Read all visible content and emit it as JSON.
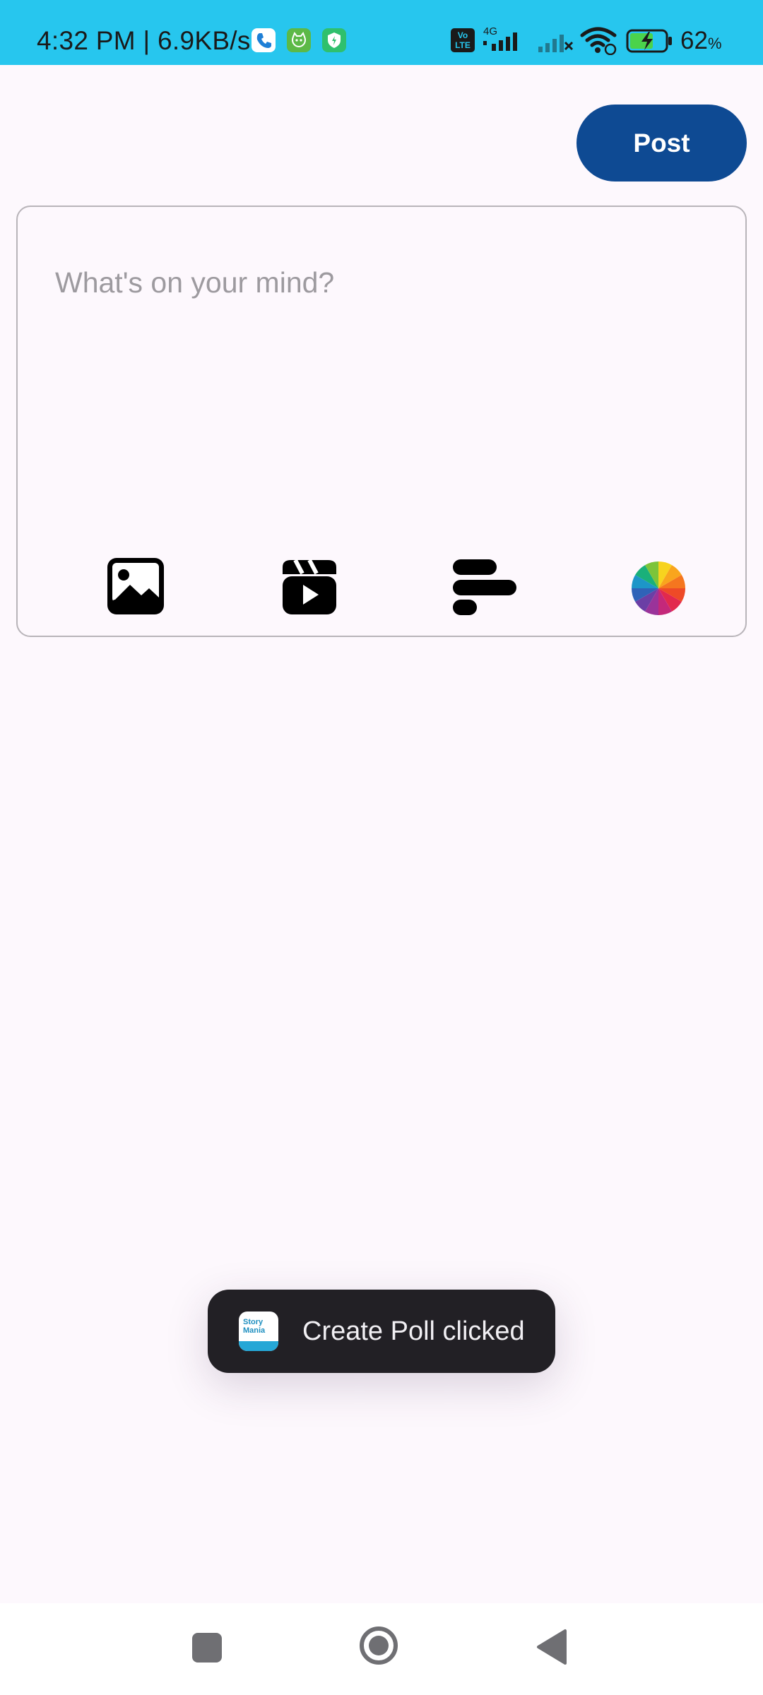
{
  "status_bar": {
    "time": "4:32 PM",
    "separator": "|",
    "net_speed": "6.9KB/s",
    "volte_line1": "Vo",
    "volte_line2": "LTE",
    "network_type": "4G",
    "battery_percent": "62",
    "battery_unit": "%",
    "notification_icons": [
      "phone-icon",
      "cat-app-icon",
      "shield-app-icon"
    ],
    "system_icons": [
      "volte-icon",
      "signal-4g-icon",
      "signal-noservice-icon",
      "wifi-icon",
      "battery-charging-icon"
    ]
  },
  "composer": {
    "post_label": "Post",
    "placeholder": "What's on your mind?",
    "value": "",
    "tools": [
      {
        "name": "image-icon",
        "label": "Add image"
      },
      {
        "name": "video-icon",
        "label": "Add video"
      },
      {
        "name": "poll-icon",
        "label": "Create poll"
      },
      {
        "name": "color-wheel-icon",
        "label": "Background color"
      }
    ]
  },
  "toast": {
    "app_name_line1": "Story",
    "app_name_line2": "Mania",
    "message": "Create Poll clicked"
  },
  "nav_bar": {
    "buttons": [
      "recents-icon",
      "home-icon",
      "back-icon"
    ]
  },
  "colors": {
    "status_bar_bg": "#27c6ee",
    "background": "#fdf8fd",
    "accent_button": "#0e4a93",
    "toast_bg": "#222025",
    "card_border": "#b8b4b9",
    "placeholder_text": "#9d9a9f"
  }
}
